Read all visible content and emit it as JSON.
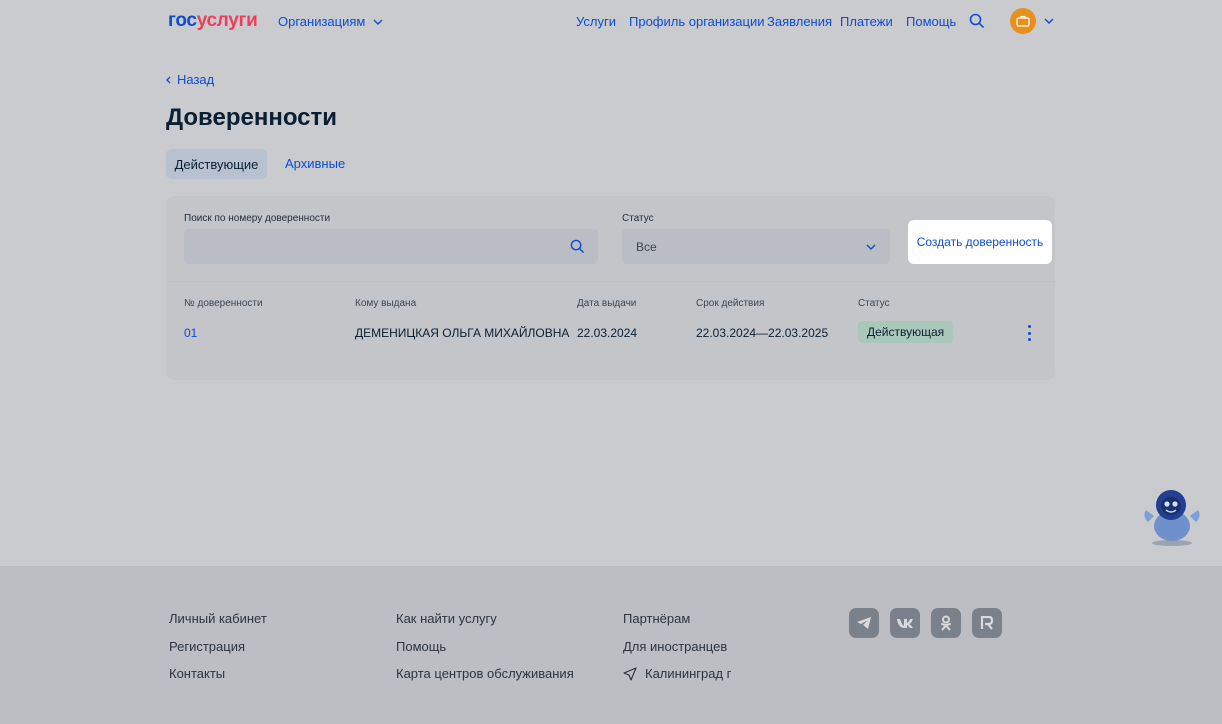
{
  "header": {
    "logo_part1": "гос",
    "logo_part2": "услуги",
    "orgs_label": "Организациям",
    "nav": [
      "Услуги",
      "Профиль организации",
      "Заявления",
      "Платежи",
      "Помощь"
    ]
  },
  "page": {
    "back_label": "Назад",
    "title": "Доверенности",
    "tabs": [
      "Действующие",
      "Архивные"
    ]
  },
  "filters": {
    "search_label": "Поиск по номеру доверенности",
    "search_value": "",
    "status_label": "Статус",
    "status_value": "Все",
    "create_button": "Создать доверенность"
  },
  "table": {
    "headers": [
      "№ доверенности",
      "Кому выдана",
      "Дата выдачи",
      "Срок действия",
      "Статус"
    ],
    "rows": [
      {
        "number": "01",
        "issued_to": "ДЕМЕНИЦКАЯ ОЛЬГА МИХАЙЛОВНА",
        "issue_date": "22.03.2024",
        "validity": "22.03.2024—22.03.2025",
        "status": "Действующая"
      }
    ]
  },
  "footer": {
    "col1": [
      "Личный кабинет",
      "Регистрация",
      "Контакты"
    ],
    "col2": [
      "Как найти услугу",
      "Помощь",
      "Карта центров обслуживания"
    ],
    "col3": [
      "Партнёрам",
      "Для иностранцев",
      "Калининград г"
    ],
    "socials": [
      "telegram-icon",
      "vk-icon",
      "ok-icon",
      "rutube-icon"
    ]
  },
  "colors": {
    "accent": "#0d4cd3",
    "brand_red": "#ee3f58",
    "status_active_bg": "#a9c8b9"
  }
}
